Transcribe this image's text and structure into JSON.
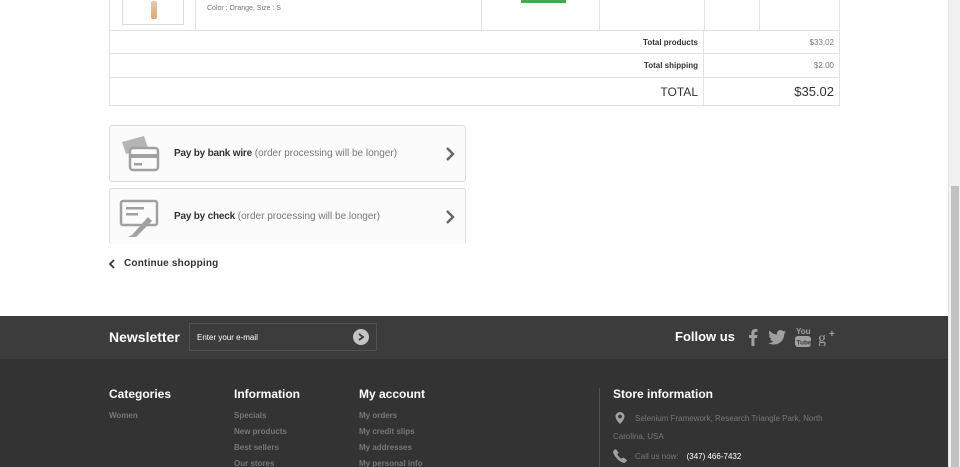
{
  "cart": {
    "product_attributes": "Color : Orange, Size : S",
    "rows": [
      {
        "label": "Total products",
        "value": "$33.02"
      },
      {
        "label": "Total shipping",
        "value": "$2.00"
      },
      {
        "label": "TOTAL",
        "value": "$35.02"
      }
    ]
  },
  "payment": {
    "bankwire": {
      "title": "Pay by bank wire",
      "note": "(order processing will be longer)"
    },
    "cheque": {
      "title": "Pay by check",
      "note": "(order processing will be longer)"
    }
  },
  "continue_label": "Continue shopping",
  "newsletter": {
    "title": "Newsletter",
    "placeholder": "Enter your e-mail"
  },
  "follow": {
    "title": "Follow us",
    "icons": [
      "facebook-icon",
      "twitter-icon",
      "youtube-icon",
      "google-plus-icon"
    ]
  },
  "footer": {
    "categories": {
      "title": "Categories",
      "links": [
        "Women"
      ]
    },
    "information": {
      "title": "Information",
      "links": [
        "Specials",
        "New products",
        "Best sellers",
        "Our stores"
      ]
    },
    "account": {
      "title": "My account",
      "links": [
        "My orders",
        "My credit slips",
        "My addresses",
        "My personal info"
      ]
    },
    "store": {
      "title": "Store information",
      "address_line1": "Selenium Framework, Research Triangle Park, North",
      "address_line2": "Carolina, USA",
      "call_label": "Call us now:",
      "phone": "(347) 466-7432"
    }
  },
  "colors": {
    "footer_dark": "#333333",
    "footer_band": "#3c3c3c",
    "accent_green": "#46a74e"
  }
}
